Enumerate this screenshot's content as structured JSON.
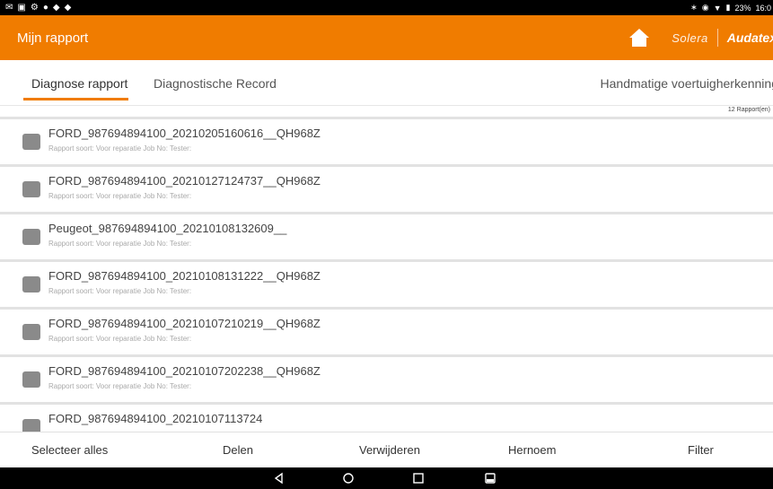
{
  "status_bar": {
    "left_icons": [
      "mail-icon",
      "image-icon",
      "settings-icon",
      "person-icon",
      "vpn-icon",
      "shield-icon"
    ],
    "battery": "23%",
    "time": "16:0"
  },
  "app_bar": {
    "title": "Mijn rapport",
    "brand_solera": "Solera",
    "brand_audatex": "Audatex",
    "accent_color": "#f07c00"
  },
  "tabs": {
    "diagnose": "Diagnose rapport",
    "record": "Diagnostische Record",
    "right": "Handmatige voertuigherkenning"
  },
  "report_count": "12 Rapport(en)",
  "reports": [
    {
      "title": "FORD_987694894100_20210205160616__QH968Z",
      "subtitle": "Rapport soort: Voor reparatie   Job No:   Tester:"
    },
    {
      "title": "FORD_987694894100_20210127124737__QH968Z",
      "subtitle": "Rapport soort: Voor reparatie   Job No:   Tester:"
    },
    {
      "title": "Peugeot_987694894100_20210108132609__",
      "subtitle": "Rapport soort: Voor reparatie   Job No:   Tester:"
    },
    {
      "title": "FORD_987694894100_20210108131222__QH968Z",
      "subtitle": "Rapport soort: Voor reparatie   Job No:   Tester:"
    },
    {
      "title": "FORD_987694894100_20210107210219__QH968Z",
      "subtitle": "Rapport soort: Voor reparatie   Job No:   Tester:"
    },
    {
      "title": "FORD_987694894100_20210107202238__QH968Z",
      "subtitle": "Rapport soort: Voor reparatie   Job No:   Tester:"
    },
    {
      "title": "FORD_987694894100_20210107113724",
      "subtitle": ""
    }
  ],
  "bottom_bar": {
    "select_all": "Selecteer alles",
    "share": "Delen",
    "delete": "Verwijderen",
    "rename": "Hernoem",
    "filter": "Filter"
  }
}
